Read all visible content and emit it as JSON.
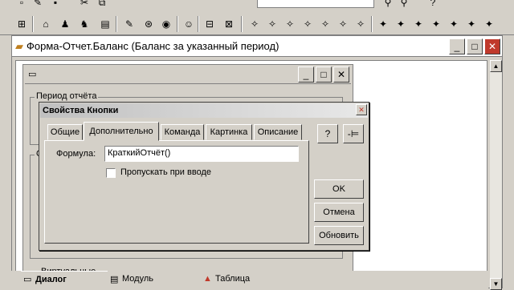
{
  "document_window": {
    "title": "Форма-Отчет.Баланс (Баланс за указанный период)",
    "btn_minimize": "_",
    "btn_maximize": "□",
    "btn_close": "✕"
  },
  "form_window": {
    "btn_minimize": "_",
    "btn_maximize": "□",
    "btn_close": "✕",
    "group_period": "Период отчёта",
    "group_partial": "От",
    "bottom_text": "Виртуальные"
  },
  "dialog": {
    "title": "Свойства Кнопки",
    "tabs": [
      "Общие",
      "Дополнительно",
      "Команда",
      "Картинка",
      "Описание"
    ],
    "active_tab": "Дополнительно",
    "formula_label": "Формула:",
    "formula_value": "КраткийОтчёт()",
    "skip_checkbox_label": "Пропускать при вводе",
    "help_button": "?",
    "pin_button": "-⊨",
    "ok_button": "OK",
    "cancel_button": "Отмена",
    "update_button": "Обновить"
  },
  "bottom_tabs": {
    "dialog": "Диалог",
    "module": "Модуль",
    "table": "Таблица"
  },
  "colors": {
    "face": "#d4d0c8",
    "close_accent": "#c0392b",
    "input_bg": "#fff"
  }
}
